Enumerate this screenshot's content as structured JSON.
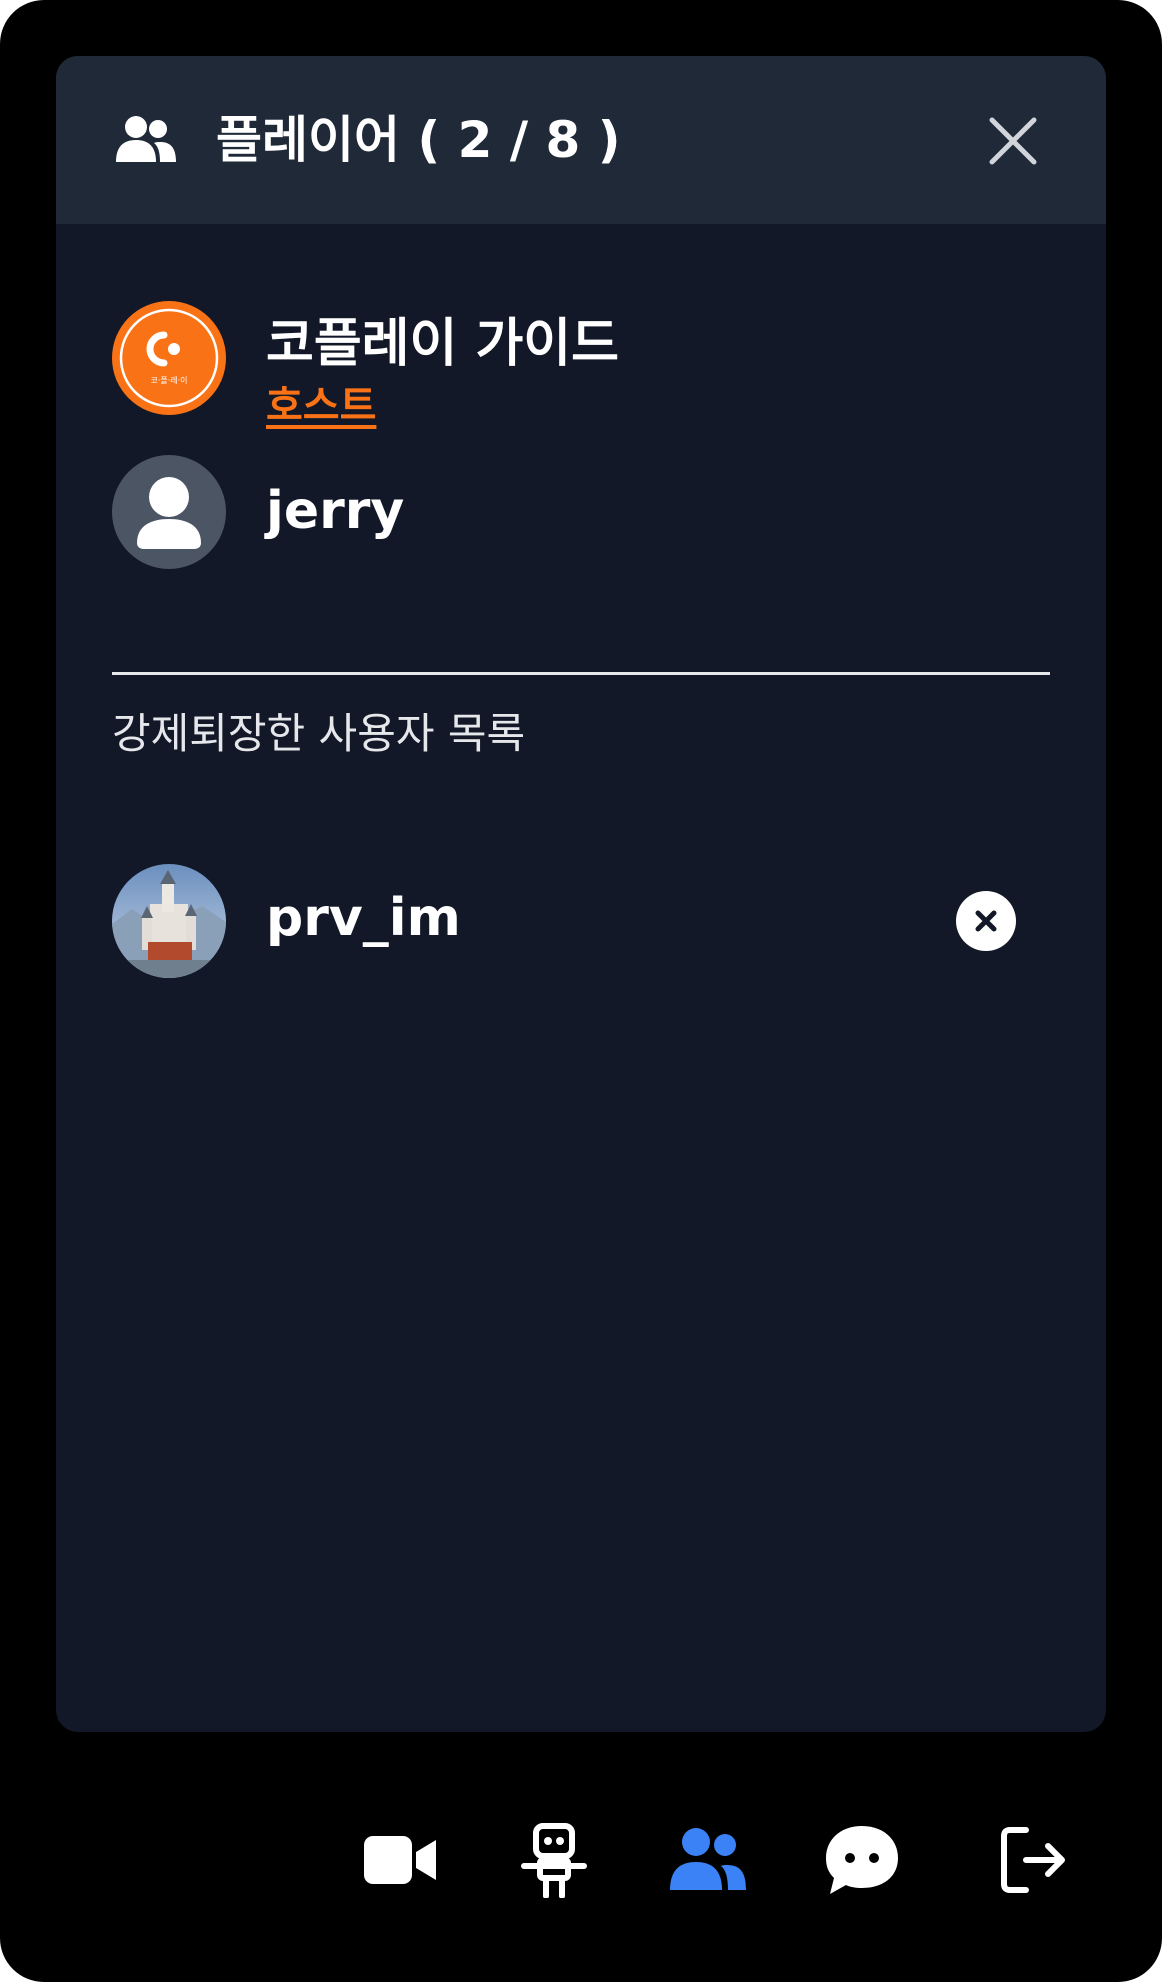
{
  "panel": {
    "header": {
      "title": "플레이어 ( 2 / 8 )",
      "icon": "users-icon",
      "close_icon": "close-icon"
    },
    "players": [
      {
        "name": "코플레이 가이드",
        "badge": "호스트",
        "avatar": "coplay-logo",
        "avatar_text": "코·플·레·이"
      },
      {
        "name": "jerry",
        "avatar": "default-user-icon"
      }
    ],
    "banned_section": {
      "label": "강제퇴장한 사용자 목록",
      "users": [
        {
          "name": "prv_im",
          "avatar": "castle-photo",
          "action_icon": "remove-circle-icon"
        }
      ]
    }
  },
  "dock": {
    "items": [
      {
        "icon": "video-camera-icon",
        "active": false
      },
      {
        "icon": "robot-icon",
        "active": false
      },
      {
        "icon": "users-icon",
        "active": true
      },
      {
        "icon": "chat-bubble-icon",
        "active": false
      },
      {
        "icon": "logout-icon",
        "active": false
      }
    ]
  },
  "colors": {
    "background": "#000000",
    "panel": "#121827",
    "header": "#1f2937",
    "accent_orange": "#f97316",
    "active_blue": "#3b82f6",
    "text": "#ffffff"
  }
}
